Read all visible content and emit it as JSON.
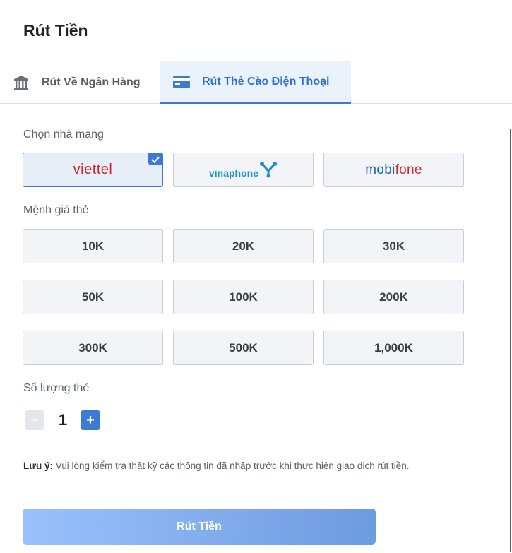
{
  "page_title": "Rút Tiền",
  "tabs": [
    {
      "label": "Rút Về Ngân Hàng",
      "icon": "bank-icon",
      "active": false
    },
    {
      "label": "Rút Thẻ Cào Điện Thoại",
      "icon": "credit-card-icon",
      "active": true
    }
  ],
  "carrier": {
    "label": "Chọn nhà mạng",
    "options": [
      {
        "name": "viettel",
        "text": "viettel",
        "selected": true
      },
      {
        "name": "vinaphone",
        "text": "vinaphone",
        "selected": false
      },
      {
        "name": "mobifone",
        "text_a": "mobi",
        "text_b": "fone",
        "selected": false
      }
    ]
  },
  "denomination": {
    "label": "Mệnh giá thẻ",
    "options": [
      "10K",
      "20K",
      "30K",
      "50K",
      "100K",
      "200K",
      "300K",
      "500K",
      "1,000K"
    ]
  },
  "quantity": {
    "label": "Số lượng thẻ",
    "minus": "−",
    "value": "1",
    "plus": "+"
  },
  "note": {
    "prefix": "Lưu ý:",
    "text": " Vui lòng kiểm tra thật kỹ các thông tin đã nhập trước khi thực hiện giao dịch rút tiền."
  },
  "submit_label": "Rút Tiền",
  "colors": {
    "accent": "#3d7ad6",
    "viettel": "#d2252b",
    "vinaphone": "#1d8fd0",
    "mobifone_blue": "#1a63b0",
    "mobifone_red": "#d0262d"
  }
}
